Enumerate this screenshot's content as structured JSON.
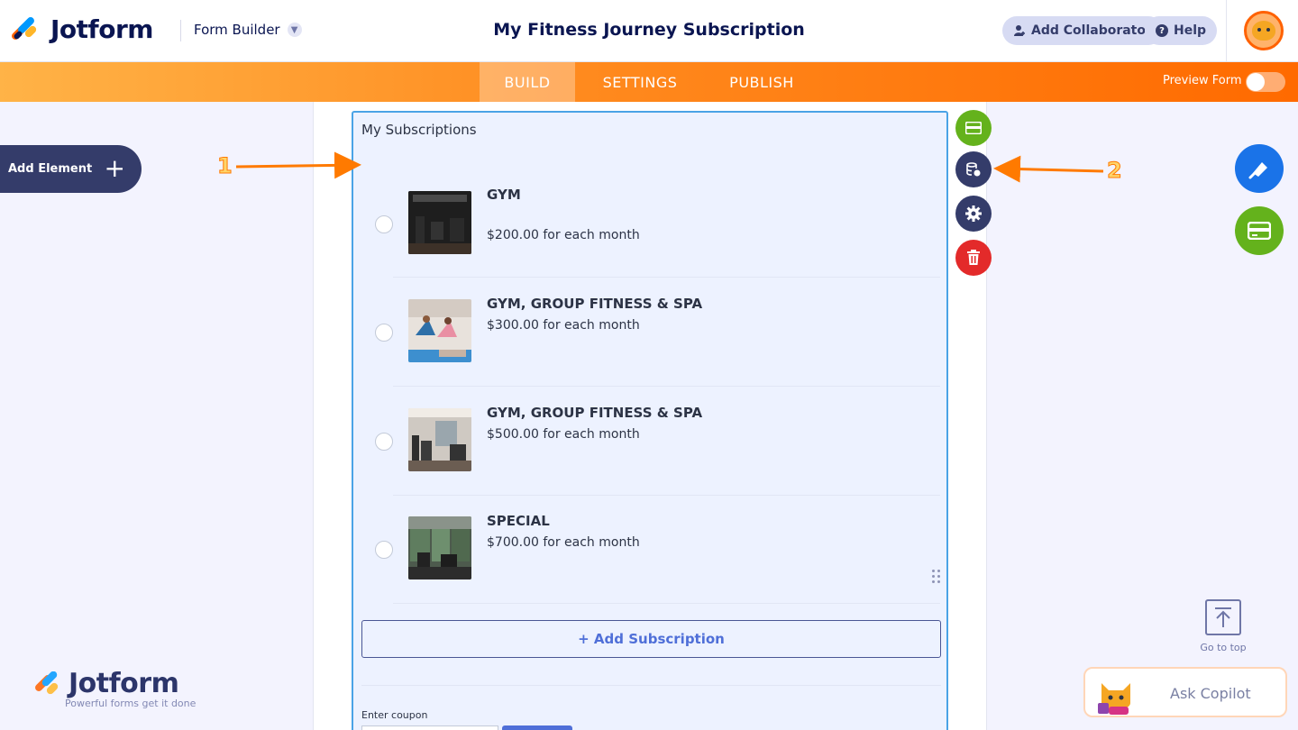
{
  "header": {
    "logo_text": "Jotform",
    "app_name": "Form Builder",
    "form_title": "My Fitness Journey Subscription",
    "add_collaborator": "Add Collaborator",
    "help": "Help"
  },
  "nav": {
    "tabs": [
      {
        "label": "BUILD",
        "active": true
      },
      {
        "label": "SETTINGS",
        "active": false
      },
      {
        "label": "PUBLISH",
        "active": false
      }
    ],
    "preview_label": "Preview Form",
    "preview_on": false
  },
  "sidebar": {
    "add_element": "Add Element"
  },
  "field": {
    "label": "My Subscriptions",
    "items": [
      {
        "name": "GYM",
        "price": "$200.00 for each month"
      },
      {
        "name": "GYM, GROUP FITNESS & SPA",
        "price": "$300.00 for each month"
      },
      {
        "name": "GYM, GROUP FITNESS & SPA",
        "price": "$500.00 for each month"
      },
      {
        "name": "SPECIAL",
        "price": "$700.00 for each month"
      }
    ],
    "add_subscription": "+ Add Subscription",
    "coupon_label": "Enter coupon"
  },
  "right_panel": {
    "go_to_top": "Go to top",
    "ask_copilot": "Ask Copilot"
  },
  "footer": {
    "logo_text": "Jotform",
    "tagline": "Powerful forms get it done"
  },
  "annotations": {
    "one": "1",
    "two": "2"
  },
  "colors": {
    "orange": "#ff6a00",
    "navy": "#0a1551",
    "green": "#64b21c",
    "red": "#e32a2a",
    "blue": "#1a73e8",
    "field_border": "#4aa3e6"
  }
}
